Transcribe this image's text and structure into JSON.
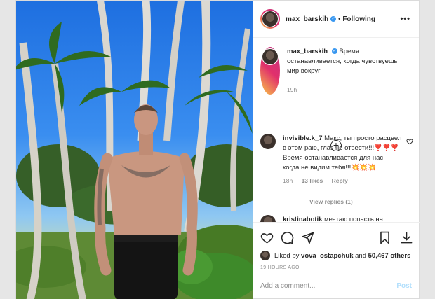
{
  "header": {
    "username": "max_barskih",
    "separator": "•",
    "follow_status": "Following",
    "more_label": "•••"
  },
  "caption": {
    "username": "max_barskih",
    "text": "Время останавливается, когда чувствуешь мир вокруг",
    "age": "19h"
  },
  "comments": [
    {
      "username": "invisible.k_7",
      "text": "Макс, ты просто расцвел в этом раю, глаз не отвести!!!❣️❣️❣️ Время останавливается для нас, когда не видим тебя!!!💥💥💥",
      "age": "18h",
      "likes": "13 likes",
      "reply_label": "Reply",
      "view_replies": "View replies (1)"
    },
    {
      "username": "kristinabotik",
      "text": "мечтаю попасть на"
    }
  ],
  "likes": {
    "prefix": "Liked by",
    "user": "vova_ostapchuk",
    "and": "and",
    "count": "50,467 others"
  },
  "timestamp": "19 HOURS AGO",
  "add_comment": {
    "placeholder": "Add a comment...",
    "post_label": "Post"
  },
  "icons": {
    "like": "heart-icon",
    "comment": "comment-icon",
    "share": "share-icon",
    "save": "bookmark-icon",
    "download": "download-icon",
    "add": "plus-circle-icon"
  },
  "colors": {
    "verified": "#3897f0",
    "post_disabled": "#b2dffc",
    "muted_text": "#8e8e8e"
  }
}
